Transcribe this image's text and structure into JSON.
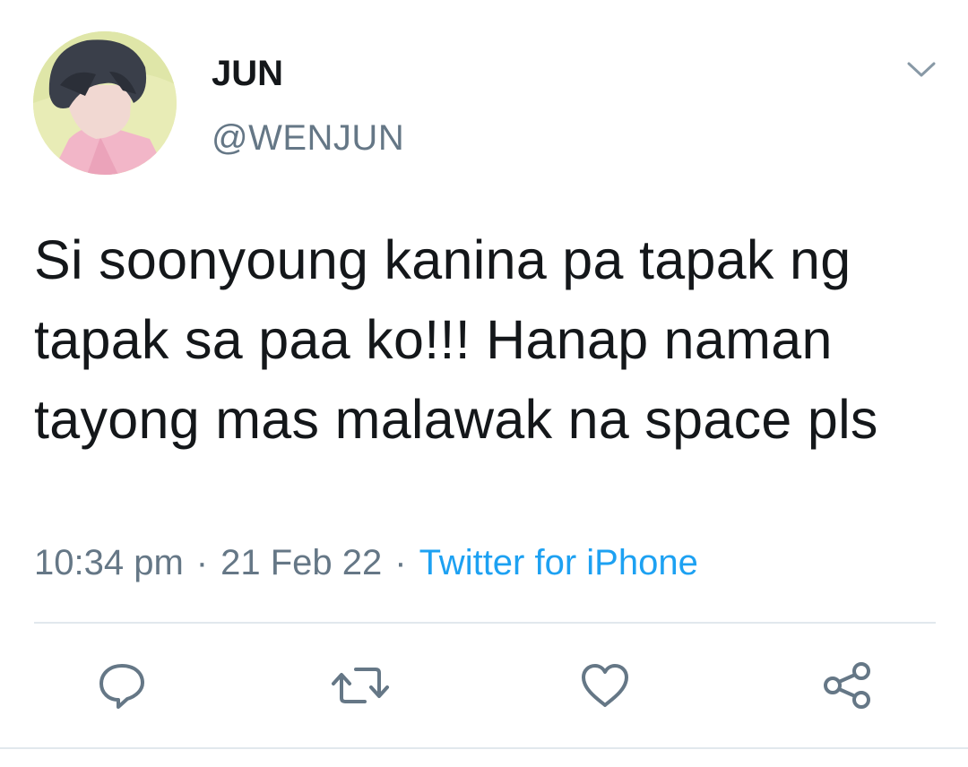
{
  "user": {
    "display_name": "JUN",
    "handle": "@WENJUN"
  },
  "tweet": {
    "text": "Si soonyoung kanina pa tapak ng tapak sa paa ko!!! Hanap naman tayong mas malawak na space pls",
    "time": "10:34 pm",
    "date": "21 Feb 22",
    "source": "Twitter for iPhone",
    "separator": "·"
  },
  "icons": {
    "menu": "chevron-down-icon",
    "reply": "reply-icon",
    "retweet": "retweet-icon",
    "like": "heart-icon",
    "share": "share-icon"
  },
  "colors": {
    "text": "#14171a",
    "secondary": "#657786",
    "link": "#1da1f2",
    "divider": "#e1e8ed"
  }
}
